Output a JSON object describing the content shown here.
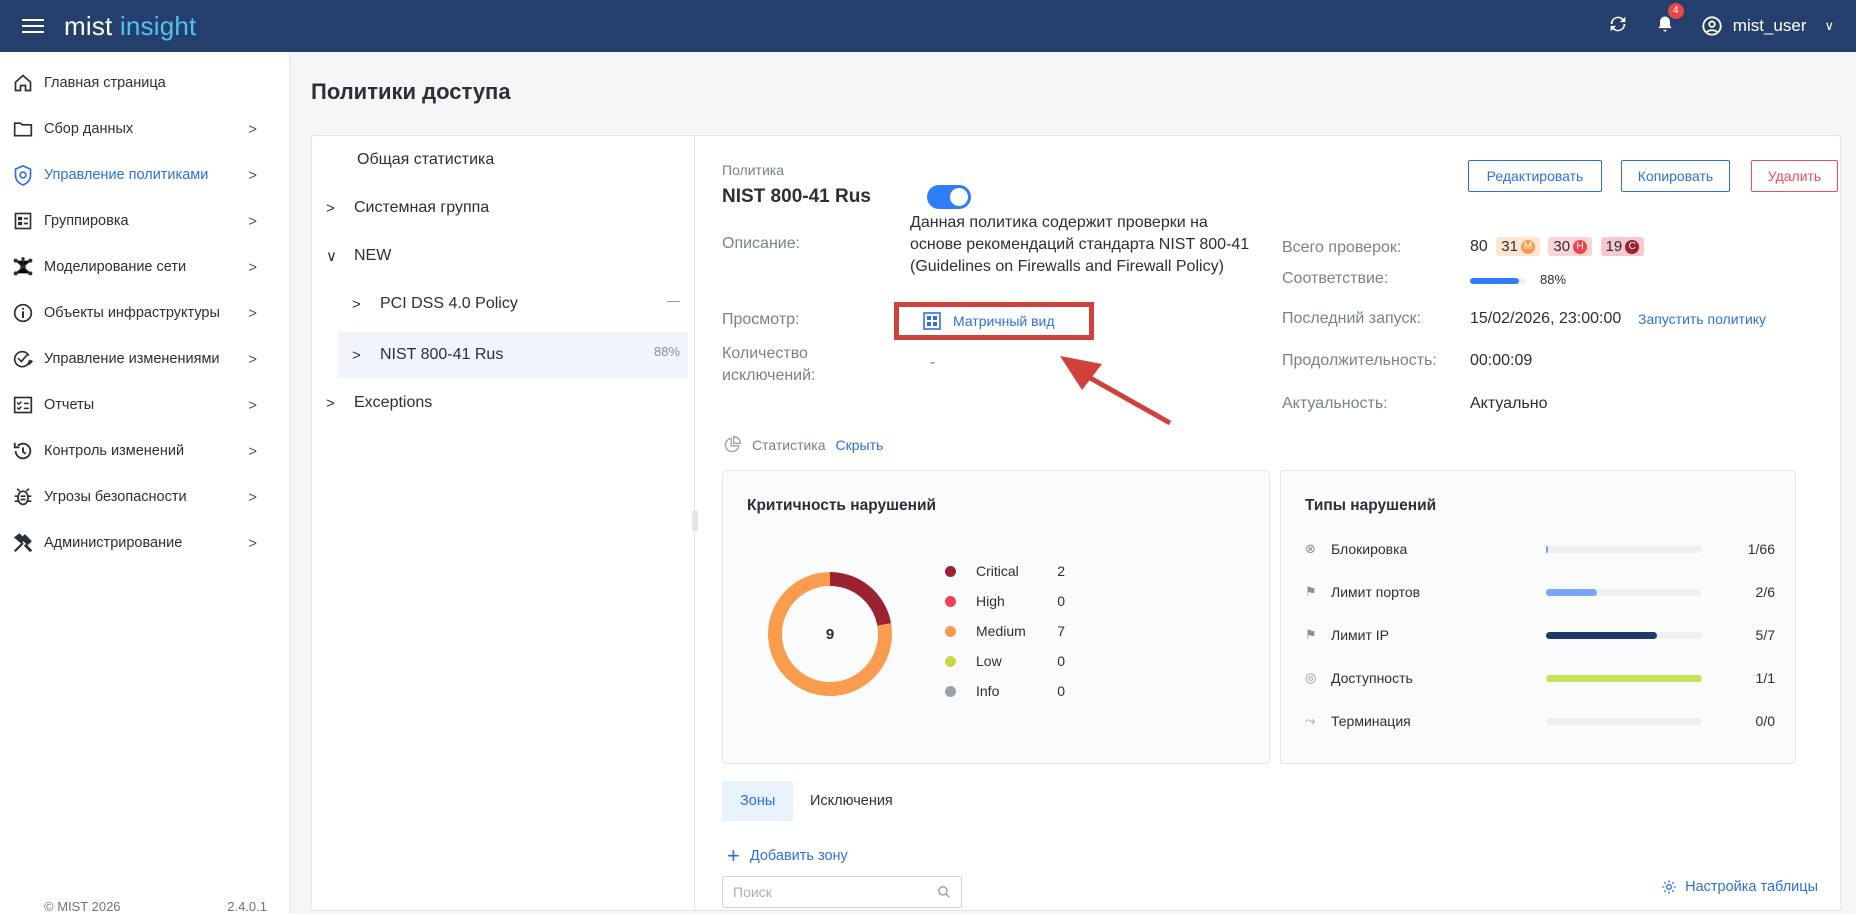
{
  "header": {
    "logo_main": "mist",
    "logo_accent": "insight",
    "notifications_count": "4",
    "username": "mist_user"
  },
  "sidebar": {
    "items": [
      {
        "label": "Главная страница",
        "icon": "home-icon"
      },
      {
        "label": "Сбор данных",
        "icon": "folder-icon"
      },
      {
        "label": "Управление политиками",
        "icon": "shield-icon",
        "active": true
      },
      {
        "label": "Группировка",
        "icon": "grouping-icon"
      },
      {
        "label": "Моделирование сети",
        "icon": "network-icon"
      },
      {
        "label": "Объекты инфраструктуры",
        "icon": "info-icon"
      },
      {
        "label": "Управление изменениями",
        "icon": "check-edit-icon"
      },
      {
        "label": "Отчеты",
        "icon": "report-icon"
      },
      {
        "label": "Контроль изменений",
        "icon": "history-icon"
      },
      {
        "label": "Угрозы безопасности",
        "icon": "bug-icon"
      },
      {
        "label": "Администрирование",
        "icon": "tools-icon"
      }
    ],
    "footer_copyright": "© MIST 2026",
    "footer_version": "2.4.0.1"
  },
  "page": {
    "title": "Политики доступа"
  },
  "tree": {
    "overall_stats": "Общая статистика",
    "system_group": "Системная группа",
    "new_group": "NEW",
    "pci_policy": "PCI DSS 4.0 Policy",
    "pci_value": "—",
    "nist_policy": "NIST 800-41 Rus",
    "nist_value": "88%",
    "exceptions": "Exceptions"
  },
  "policy": {
    "section_label": "Политика",
    "name": "NIST 800-41 Rus",
    "enabled": true,
    "buttons": {
      "edit": "Редактировать",
      "copy": "Копировать",
      "delete": "Удалить"
    },
    "description_label": "Описание:",
    "description_line1": "Данная политика содержит проверки на",
    "description_line2": "основе рекомендаций стандарта NIST 800-41",
    "description_line3": "(Guidelines on Firewalls and Firewall Policy)",
    "view_label": "Просмотр:",
    "matrix_view": "Матричный вид",
    "exceptions_label_line1": "Количество",
    "exceptions_label_line2": "исключений:",
    "exceptions_value": "-",
    "total_checks_label": "Всего проверок:",
    "total_checks": "80",
    "medium_count": "31",
    "medium_letter": "M",
    "high_count": "30",
    "high_letter": "H",
    "critical_count": "19",
    "critical_letter": "C",
    "compliance_label": "Соответствие:",
    "compliance_value": "88%",
    "compliance_fraction": 0.88,
    "last_run_label": "Последний запуск:",
    "last_run_value": "15/02/2026, 23:00:00",
    "run_policy": "Запустить политику",
    "duration_label": "Продолжительность:",
    "duration_value": "00:00:09",
    "relevance_label": "Актуальность:",
    "relevance_value": "Актуально"
  },
  "stats": {
    "label": "Статистика",
    "hide": "Скрыть"
  },
  "severity_panel": {
    "title": "Критичность нарушений",
    "total": "9",
    "items": [
      {
        "name": "Critical",
        "value": "2",
        "color": "#9b2230"
      },
      {
        "name": "High",
        "value": "0",
        "color": "#ef4350"
      },
      {
        "name": "Medium",
        "value": "7",
        "color": "#fa9c4e"
      },
      {
        "name": "Low",
        "value": "0",
        "color": "#c9d84a"
      },
      {
        "name": "Info",
        "value": "0",
        "color": "#9aa0a8"
      }
    ]
  },
  "types_panel": {
    "title": "Типы нарушений",
    "items": [
      {
        "name": "Блокировка",
        "value": "1/66",
        "fraction": 0.015,
        "color": "#6fa4f5",
        "icon": "block-icon"
      },
      {
        "name": "Лимит портов",
        "value": "2/6",
        "fraction": 0.33,
        "color": "#77a7f4",
        "icon": "port-limit-icon"
      },
      {
        "name": "Лимит IP",
        "value": "5/7",
        "fraction": 0.71,
        "color": "#1f3a66",
        "icon": "ip-limit-icon"
      },
      {
        "name": "Доступность",
        "value": "1/1",
        "fraction": 1.0,
        "color": "#c4e55a",
        "icon": "availability-icon"
      },
      {
        "name": "Терминация",
        "value": "0/0",
        "fraction": 0,
        "color": "#c4e55a",
        "icon": "termination-icon"
      }
    ]
  },
  "tabs": {
    "zones": "Зоны",
    "exceptions": "Исключения"
  },
  "add_zone": "Добавить зону",
  "search_placeholder": "Поиск",
  "table_settings": "Настройка таблицы",
  "colors": {
    "topbar": "#243f6b",
    "accent": "#2f6fe0",
    "annotation": "#d0413c"
  }
}
